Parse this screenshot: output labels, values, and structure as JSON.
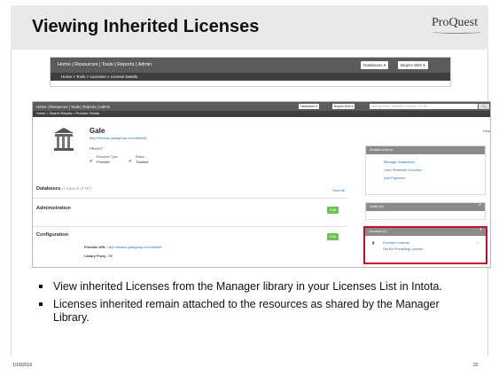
{
  "slide": {
    "title": "Viewing Inherited Licenses",
    "logo": "ProQuest",
    "date": "1/18/2016",
    "page_number": "22",
    "bullets": [
      "View inherited Licenses from the Manager library in your Licenses List in Intota.",
      "Licenses inherited remain attached to the resources as shared by the Manager Library."
    ]
  },
  "back_screenshot": {
    "nav": "Home  |  Resources  |  Tools  |  Reports  |  Admin",
    "breadcrumb": "Home  >  Tools  >  Licenses  >  License Details",
    "databases_select": "Databases ▾",
    "begins_with_select": "Begins With ▾"
  },
  "front_screenshot": {
    "nav": "Home  |  Resources  |  Tools  |  Reports  |  Admin",
    "breadcrumb": "Home  >  Search Results  >  Provider Details",
    "databases_select": "Databases ▾",
    "begins_with_select": "Begins With ▾",
    "search_placeholder": "Specify name, identifier, keyword, or URL",
    "search_button": "🔍",
    "help": "Help",
    "provider_name": "Gale",
    "provider_url": "http://infotrac.galegroup.com/default",
    "provider_code": "PRVGIT",
    "resource_type_label": "Resource Type",
    "resource_type_value": "Provider",
    "status_label": "Status",
    "status_value": "Tracked",
    "databases_label": "Databases",
    "databases_note": "(1 tracked of 787)",
    "view_all": "View All",
    "administration_label": "Administration",
    "configuration_label": "Configuration",
    "edit_label": "Edit",
    "provider_url_label": "Provider URL",
    "provider_url_value": "http://infotrac.galegroup.com/default",
    "library_proxy_label": "Library Proxy",
    "library_proxy_value": "Off",
    "related_actions_title": "Related Actions",
    "related_actions": [
      "Manage Databases",
      "View Renewal Checklist",
      "Add Payment"
    ],
    "notes_title": "Notes (0)",
    "licenses_title": "Licenses (1)",
    "licenses_links": [
      "Provider License",
      "Set As Prevailing License"
    ],
    "plus": "+",
    "close_x": "×",
    "check_mark": "✔",
    "doc_icon": "▮"
  }
}
